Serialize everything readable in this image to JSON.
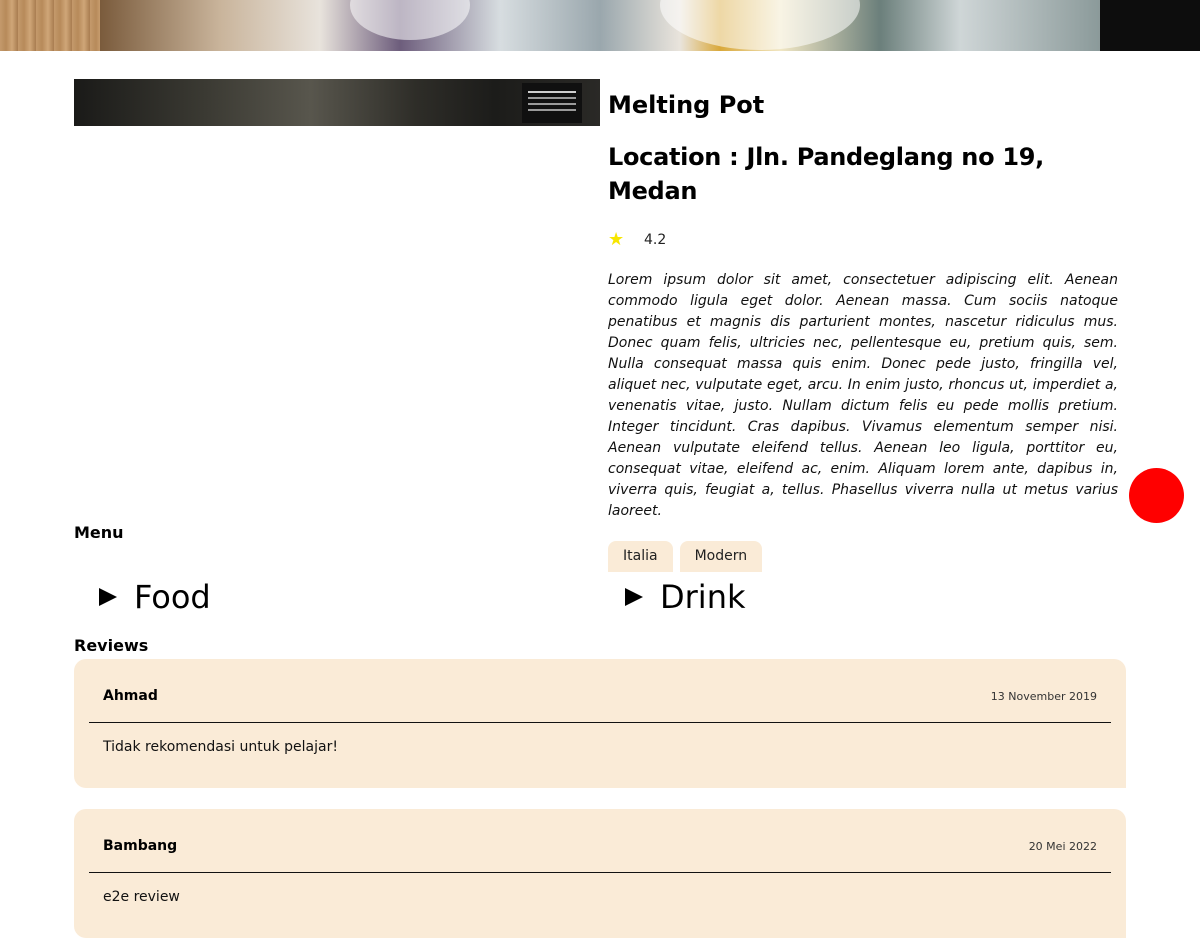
{
  "restaurant": {
    "name": "Melting Pot",
    "location": "Location : Jln. Pandeglang no 19, Medan",
    "rating": "4.2",
    "description": "Lorem ipsum dolor sit amet, consectetuer adipiscing elit. Aenean commodo ligula eget dolor. Aenean massa. Cum sociis natoque penatibus et magnis dis parturient montes, nascetur ridiculus mus. Donec quam felis, ultricies nec, pellentesque eu, pretium quis, sem. Nulla consequat massa quis enim. Donec pede justo, fringilla vel, aliquet nec, vulputate eget, arcu. In enim justo, rhoncus ut, imperdiet a, venenatis vitae, justo. Nullam dictum felis eu pede mollis pretium. Integer tincidunt. Cras dapibus. Vivamus elementum semper nisi. Aenean vulputate eleifend tellus. Aenean leo ligula, porttitor eu, consequat vitae, eleifend ac, enim. Aliquam lorem ante, dapibus in, viverra quis, feugiat a, tellus. Phasellus viverra nulla ut metus varius laoreet.",
    "tags": [
      "Italia",
      "Modern"
    ]
  },
  "menu": {
    "heading": "Menu",
    "items": [
      {
        "label": "Food"
      },
      {
        "label": "Drink"
      }
    ]
  },
  "reviews": {
    "heading": "Reviews",
    "items": [
      {
        "name": "Ahmad",
        "date": "13 November 2019",
        "text": "Tidak rekomendasi untuk pelajar!"
      },
      {
        "name": "Bambang",
        "date": "20 Mei 2022",
        "text": "e2e review"
      }
    ]
  },
  "icons": {
    "rating": "star-icon",
    "expand": "triangle-right-icon"
  },
  "colors": {
    "accent_bg": "#faebd7",
    "star": "#f7e600",
    "fab": "#ff0000"
  }
}
